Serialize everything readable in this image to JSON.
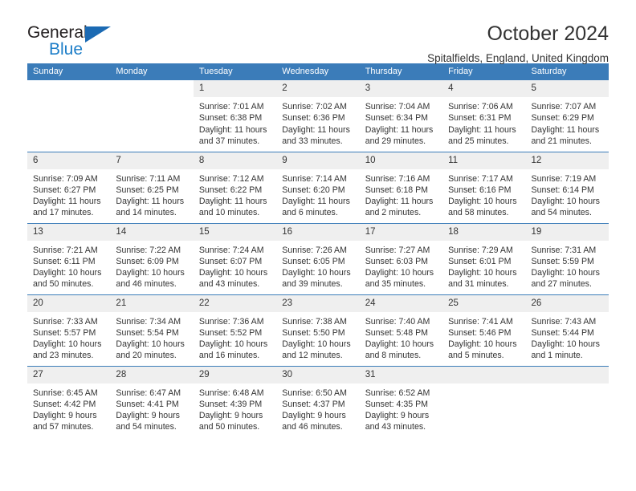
{
  "brand": {
    "word1": "General",
    "word2": "Blue",
    "logo_icon": "triangle-logo-icon",
    "accent_color": "#1b6ab3"
  },
  "header": {
    "title": "October 2024",
    "subtitle": "Spitalfields, England, United Kingdom"
  },
  "calendar": {
    "header_bg": "#3b7cb9",
    "daynum_bg": "#efefef",
    "weekdays": [
      "Sunday",
      "Monday",
      "Tuesday",
      "Wednesday",
      "Thursday",
      "Friday",
      "Saturday"
    ],
    "weeks": [
      [
        {
          "day": "",
          "sunrise": "",
          "sunset": "",
          "daylight1": "",
          "daylight2": "",
          "empty": true,
          "grey": false
        },
        {
          "day": "",
          "sunrise": "",
          "sunset": "",
          "daylight1": "",
          "daylight2": "",
          "empty": true,
          "grey": false
        },
        {
          "day": "1",
          "sunrise": "Sunrise: 7:01 AM",
          "sunset": "Sunset: 6:38 PM",
          "daylight1": "Daylight: 11 hours",
          "daylight2": "and 37 minutes.",
          "empty": false,
          "grey": true
        },
        {
          "day": "2",
          "sunrise": "Sunrise: 7:02 AM",
          "sunset": "Sunset: 6:36 PM",
          "daylight1": "Daylight: 11 hours",
          "daylight2": "and 33 minutes.",
          "empty": false,
          "grey": true
        },
        {
          "day": "3",
          "sunrise": "Sunrise: 7:04 AM",
          "sunset": "Sunset: 6:34 PM",
          "daylight1": "Daylight: 11 hours",
          "daylight2": "and 29 minutes.",
          "empty": false,
          "grey": true
        },
        {
          "day": "4",
          "sunrise": "Sunrise: 7:06 AM",
          "sunset": "Sunset: 6:31 PM",
          "daylight1": "Daylight: 11 hours",
          "daylight2": "and 25 minutes.",
          "empty": false,
          "grey": true
        },
        {
          "day": "5",
          "sunrise": "Sunrise: 7:07 AM",
          "sunset": "Sunset: 6:29 PM",
          "daylight1": "Daylight: 11 hours",
          "daylight2": "and 21 minutes.",
          "empty": false,
          "grey": true
        }
      ],
      [
        {
          "day": "6",
          "sunrise": "Sunrise: 7:09 AM",
          "sunset": "Sunset: 6:27 PM",
          "daylight1": "Daylight: 11 hours",
          "daylight2": "and 17 minutes.",
          "empty": false,
          "grey": true
        },
        {
          "day": "7",
          "sunrise": "Sunrise: 7:11 AM",
          "sunset": "Sunset: 6:25 PM",
          "daylight1": "Daylight: 11 hours",
          "daylight2": "and 14 minutes.",
          "empty": false,
          "grey": true
        },
        {
          "day": "8",
          "sunrise": "Sunrise: 7:12 AM",
          "sunset": "Sunset: 6:22 PM",
          "daylight1": "Daylight: 11 hours",
          "daylight2": "and 10 minutes.",
          "empty": false,
          "grey": true
        },
        {
          "day": "9",
          "sunrise": "Sunrise: 7:14 AM",
          "sunset": "Sunset: 6:20 PM",
          "daylight1": "Daylight: 11 hours",
          "daylight2": "and 6 minutes.",
          "empty": false,
          "grey": true
        },
        {
          "day": "10",
          "sunrise": "Sunrise: 7:16 AM",
          "sunset": "Sunset: 6:18 PM",
          "daylight1": "Daylight: 11 hours",
          "daylight2": "and 2 minutes.",
          "empty": false,
          "grey": true
        },
        {
          "day": "11",
          "sunrise": "Sunrise: 7:17 AM",
          "sunset": "Sunset: 6:16 PM",
          "daylight1": "Daylight: 10 hours",
          "daylight2": "and 58 minutes.",
          "empty": false,
          "grey": true
        },
        {
          "day": "12",
          "sunrise": "Sunrise: 7:19 AM",
          "sunset": "Sunset: 6:14 PM",
          "daylight1": "Daylight: 10 hours",
          "daylight2": "and 54 minutes.",
          "empty": false,
          "grey": true
        }
      ],
      [
        {
          "day": "13",
          "sunrise": "Sunrise: 7:21 AM",
          "sunset": "Sunset: 6:11 PM",
          "daylight1": "Daylight: 10 hours",
          "daylight2": "and 50 minutes.",
          "empty": false,
          "grey": true
        },
        {
          "day": "14",
          "sunrise": "Sunrise: 7:22 AM",
          "sunset": "Sunset: 6:09 PM",
          "daylight1": "Daylight: 10 hours",
          "daylight2": "and 46 minutes.",
          "empty": false,
          "grey": true
        },
        {
          "day": "15",
          "sunrise": "Sunrise: 7:24 AM",
          "sunset": "Sunset: 6:07 PM",
          "daylight1": "Daylight: 10 hours",
          "daylight2": "and 43 minutes.",
          "empty": false,
          "grey": true
        },
        {
          "day": "16",
          "sunrise": "Sunrise: 7:26 AM",
          "sunset": "Sunset: 6:05 PM",
          "daylight1": "Daylight: 10 hours",
          "daylight2": "and 39 minutes.",
          "empty": false,
          "grey": true
        },
        {
          "day": "17",
          "sunrise": "Sunrise: 7:27 AM",
          "sunset": "Sunset: 6:03 PM",
          "daylight1": "Daylight: 10 hours",
          "daylight2": "and 35 minutes.",
          "empty": false,
          "grey": true
        },
        {
          "day": "18",
          "sunrise": "Sunrise: 7:29 AM",
          "sunset": "Sunset: 6:01 PM",
          "daylight1": "Daylight: 10 hours",
          "daylight2": "and 31 minutes.",
          "empty": false,
          "grey": true
        },
        {
          "day": "19",
          "sunrise": "Sunrise: 7:31 AM",
          "sunset": "Sunset: 5:59 PM",
          "daylight1": "Daylight: 10 hours",
          "daylight2": "and 27 minutes.",
          "empty": false,
          "grey": true
        }
      ],
      [
        {
          "day": "20",
          "sunrise": "Sunrise: 7:33 AM",
          "sunset": "Sunset: 5:57 PM",
          "daylight1": "Daylight: 10 hours",
          "daylight2": "and 23 minutes.",
          "empty": false,
          "grey": true
        },
        {
          "day": "21",
          "sunrise": "Sunrise: 7:34 AM",
          "sunset": "Sunset: 5:54 PM",
          "daylight1": "Daylight: 10 hours",
          "daylight2": "and 20 minutes.",
          "empty": false,
          "grey": true
        },
        {
          "day": "22",
          "sunrise": "Sunrise: 7:36 AM",
          "sunset": "Sunset: 5:52 PM",
          "daylight1": "Daylight: 10 hours",
          "daylight2": "and 16 minutes.",
          "empty": false,
          "grey": true
        },
        {
          "day": "23",
          "sunrise": "Sunrise: 7:38 AM",
          "sunset": "Sunset: 5:50 PM",
          "daylight1": "Daylight: 10 hours",
          "daylight2": "and 12 minutes.",
          "empty": false,
          "grey": true
        },
        {
          "day": "24",
          "sunrise": "Sunrise: 7:40 AM",
          "sunset": "Sunset: 5:48 PM",
          "daylight1": "Daylight: 10 hours",
          "daylight2": "and 8 minutes.",
          "empty": false,
          "grey": true
        },
        {
          "day": "25",
          "sunrise": "Sunrise: 7:41 AM",
          "sunset": "Sunset: 5:46 PM",
          "daylight1": "Daylight: 10 hours",
          "daylight2": "and 5 minutes.",
          "empty": false,
          "grey": true
        },
        {
          "day": "26",
          "sunrise": "Sunrise: 7:43 AM",
          "sunset": "Sunset: 5:44 PM",
          "daylight1": "Daylight: 10 hours",
          "daylight2": "and 1 minute.",
          "empty": false,
          "grey": true
        }
      ],
      [
        {
          "day": "27",
          "sunrise": "Sunrise: 6:45 AM",
          "sunset": "Sunset: 4:42 PM",
          "daylight1": "Daylight: 9 hours",
          "daylight2": "and 57 minutes.",
          "empty": false,
          "grey": true
        },
        {
          "day": "28",
          "sunrise": "Sunrise: 6:47 AM",
          "sunset": "Sunset: 4:41 PM",
          "daylight1": "Daylight: 9 hours",
          "daylight2": "and 54 minutes.",
          "empty": false,
          "grey": true
        },
        {
          "day": "29",
          "sunrise": "Sunrise: 6:48 AM",
          "sunset": "Sunset: 4:39 PM",
          "daylight1": "Daylight: 9 hours",
          "daylight2": "and 50 minutes.",
          "empty": false,
          "grey": true
        },
        {
          "day": "30",
          "sunrise": "Sunrise: 6:50 AM",
          "sunset": "Sunset: 4:37 PM",
          "daylight1": "Daylight: 9 hours",
          "daylight2": "and 46 minutes.",
          "empty": false,
          "grey": true
        },
        {
          "day": "31",
          "sunrise": "Sunrise: 6:52 AM",
          "sunset": "Sunset: 4:35 PM",
          "daylight1": "Daylight: 9 hours",
          "daylight2": "and 43 minutes.",
          "empty": false,
          "grey": true
        },
        {
          "day": "",
          "sunrise": "",
          "sunset": "",
          "daylight1": "",
          "daylight2": "",
          "empty": true,
          "grey": true
        },
        {
          "day": "",
          "sunrise": "",
          "sunset": "",
          "daylight1": "",
          "daylight2": "",
          "empty": true,
          "grey": true
        }
      ]
    ]
  }
}
